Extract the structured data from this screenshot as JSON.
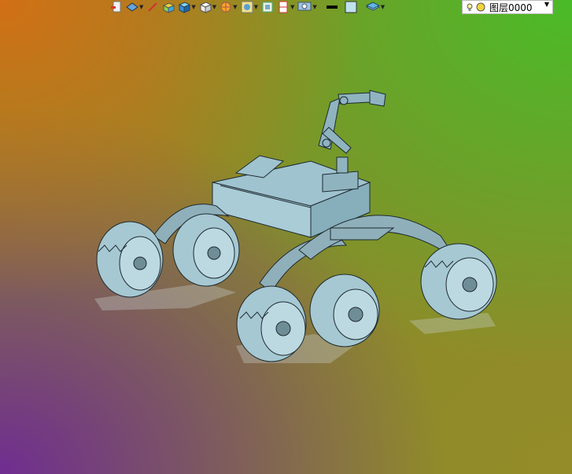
{
  "toolbar": {
    "buttons": [
      {
        "icon": "layer-props-icon",
        "dropdown": false
      },
      {
        "icon": "layer-tools-icon",
        "dropdown": true
      },
      {
        "icon": "pencil-icon",
        "dropdown": false
      },
      {
        "icon": "box-yellow-icon",
        "dropdown": false
      },
      {
        "icon": "box-blue-icon",
        "dropdown": true
      },
      {
        "icon": "view-cube-icon",
        "dropdown": true
      },
      {
        "icon": "sun-icon",
        "dropdown": true
      },
      {
        "icon": "render-icon",
        "dropdown": true
      },
      {
        "icon": "frame-icon",
        "dropdown": false
      },
      {
        "icon": "ruler-icon",
        "dropdown": true
      },
      {
        "icon": "settings-icon",
        "dropdown": true
      },
      {
        "icon": "line-weight-icon",
        "dropdown": false
      },
      {
        "icon": "color-swatch-icon",
        "dropdown": false
      },
      {
        "icon": "layers-stack-icon",
        "dropdown": true
      }
    ],
    "layer_select": {
      "value": "图层0000"
    }
  },
  "colors": {
    "swatch": "#bfe2ef",
    "model_fill": "#9fc3cf",
    "model_stroke": "#1e2a30"
  }
}
